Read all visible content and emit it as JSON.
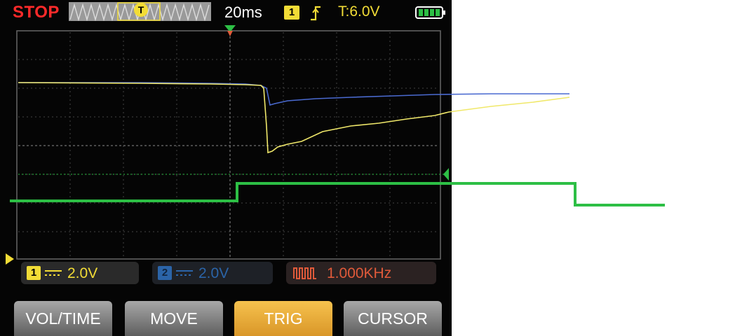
{
  "status": {
    "run_state": "STOP",
    "timebase": "20ms",
    "trigger_channel": "1",
    "trigger_level": "T:6.0V",
    "trigger_marker": "T"
  },
  "channels": {
    "ch1": {
      "badge": "1",
      "volts_per_div": "2.0V",
      "color": "#f2dc36"
    },
    "ch2": {
      "badge": "2",
      "volts_per_div": "2.0V",
      "color": "#2b64a8"
    },
    "generator": {
      "frequency": "1.000KHz",
      "color": "#e05a3a"
    }
  },
  "icons": {
    "edge": "rising-edge-icon",
    "battery": "battery-icon",
    "square_wave": "square-wave-icon",
    "dc_coupling": "dc-coupling-icon"
  },
  "menu": {
    "items": [
      "VOL/TIME",
      "MOVE",
      "TRIG",
      "CURSOR"
    ],
    "active": "TRIG"
  },
  "trace_colors": {
    "yellow": "#f0e86a",
    "blue": "#4a6ad0",
    "green": "#2dbf45",
    "grid": "#5a5a5a"
  }
}
